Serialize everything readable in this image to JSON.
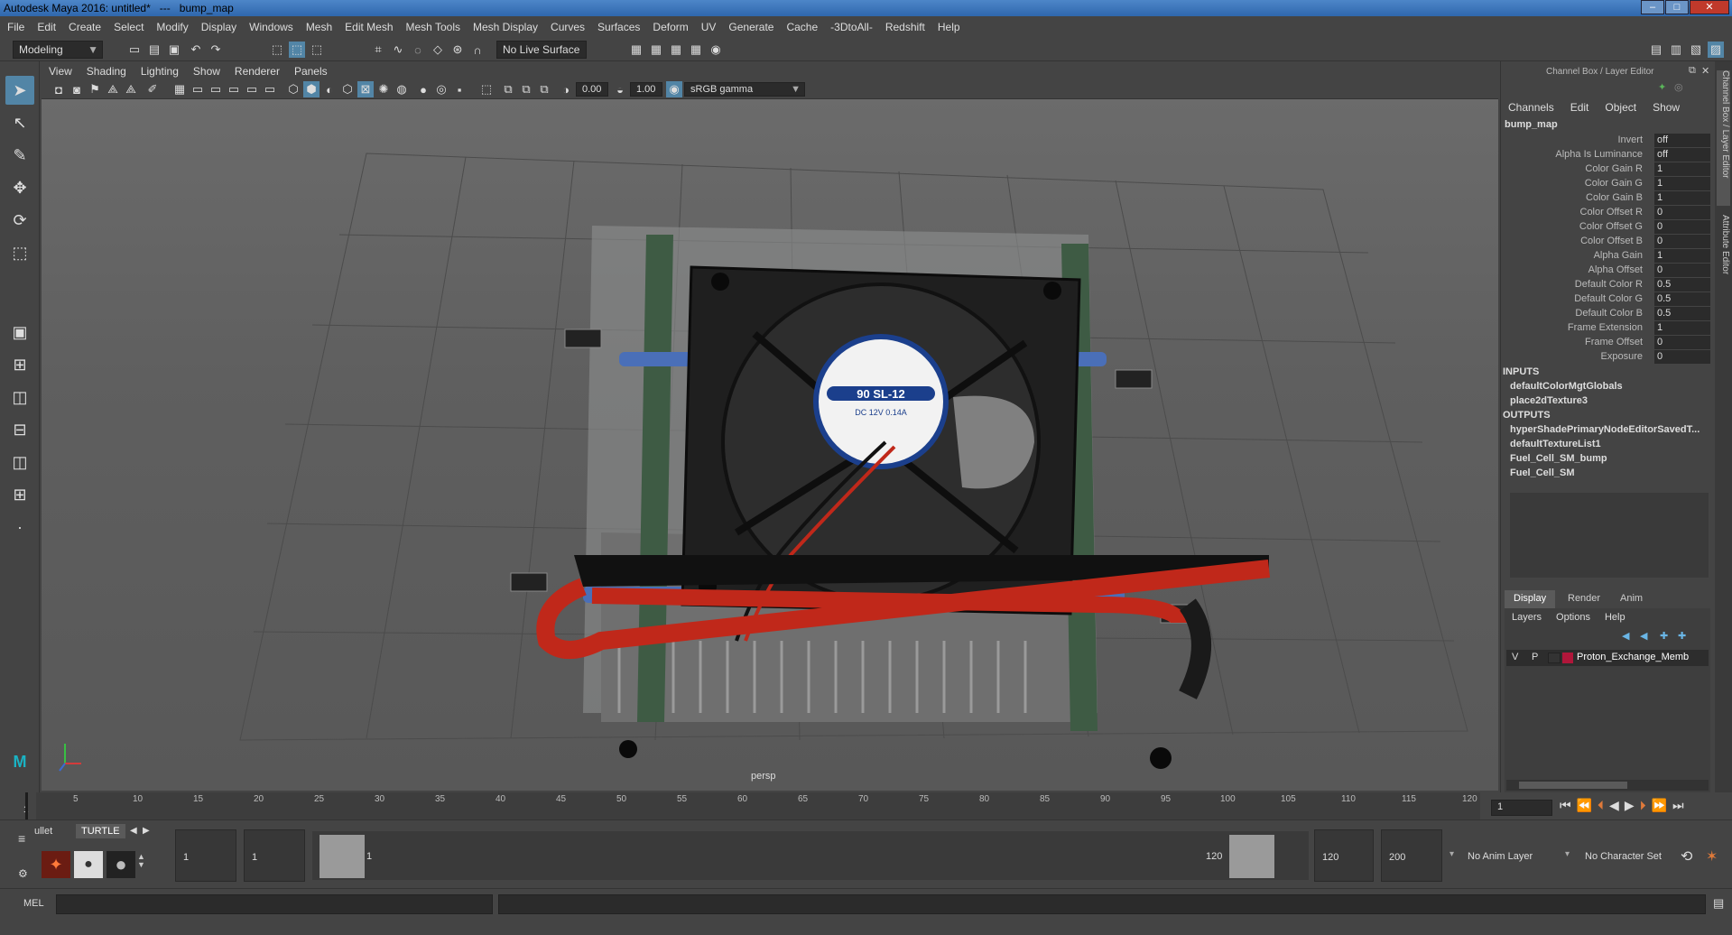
{
  "titlebar": {
    "app_title": "Autodesk Maya 2016: untitled*   ---   bump_map",
    "min": "–",
    "max": "□",
    "close": "✕"
  },
  "menus": [
    "File",
    "Edit",
    "Create",
    "Select",
    "Modify",
    "Display",
    "Windows",
    "Mesh",
    "Edit Mesh",
    "Mesh Tools",
    "Mesh Display",
    "Curves",
    "Surfaces",
    "Deform",
    "UV",
    "Generate",
    "Cache",
    "-3DtoAll-",
    "Redshift",
    "Help"
  ],
  "statusline": {
    "mode": "Modeling",
    "live_surface": "No Live Surface"
  },
  "panel_menu": [
    "View",
    "Shading",
    "Lighting",
    "Show",
    "Renderer",
    "Panels"
  ],
  "panel_toolbar": {
    "field1": "0.00",
    "field2": "1.00",
    "color_space": "sRGB gamma"
  },
  "viewport": {
    "camera_label": "persp",
    "fan_label_main": "90 SL-12",
    "fan_label_sub": "DC 12V 0.14A"
  },
  "channel_box": {
    "panel_title": "Channel Box / Layer Editor",
    "menus": [
      "Channels",
      "Edit",
      "Object",
      "Show"
    ],
    "node_name": "bump_map",
    "attributes": [
      {
        "name": "Invert",
        "value": "off"
      },
      {
        "name": "Alpha Is Luminance",
        "value": "off"
      },
      {
        "name": "Color Gain R",
        "value": "1"
      },
      {
        "name": "Color Gain G",
        "value": "1"
      },
      {
        "name": "Color Gain B",
        "value": "1"
      },
      {
        "name": "Color Offset R",
        "value": "0"
      },
      {
        "name": "Color Offset G",
        "value": "0"
      },
      {
        "name": "Color Offset B",
        "value": "0"
      },
      {
        "name": "Alpha Gain",
        "value": "1"
      },
      {
        "name": "Alpha Offset",
        "value": "0"
      },
      {
        "name": "Default Color R",
        "value": "0.5"
      },
      {
        "name": "Default Color G",
        "value": "0.5"
      },
      {
        "name": "Default Color B",
        "value": "0.5"
      },
      {
        "name": "Frame Extension",
        "value": "1"
      },
      {
        "name": "Frame Offset",
        "value": "0"
      },
      {
        "name": "Exposure",
        "value": "0"
      }
    ],
    "inputs_label": "INPUTS",
    "inputs": [
      "defaultColorMgtGlobals",
      "place2dTexture3"
    ],
    "outputs_label": "OUTPUTS",
    "outputs": [
      "hyperShadePrimaryNodeEditorSavedT...",
      "defaultTextureList1",
      "Fuel_Cell_SM_bump",
      "Fuel_Cell_SM"
    ]
  },
  "layer_editor": {
    "tabs": [
      "Display",
      "Render",
      "Anim"
    ],
    "menus": [
      "Layers",
      "Options",
      "Help"
    ],
    "layer": {
      "v": "V",
      "p": "P",
      "name": "Proton_Exchange_Memb",
      "color": "#b0163a"
    }
  },
  "side_tabs": [
    "Channel Box / Layer Editor",
    "Attribute Editor"
  ],
  "time_slider": {
    "ticks": [
      "5",
      "10",
      "15",
      "20",
      "25",
      "30",
      "35",
      "40",
      "45",
      "50",
      "55",
      "60",
      "65",
      "70",
      "75",
      "80",
      "85",
      "90",
      "95",
      "100",
      "105",
      "110",
      "115",
      "120"
    ],
    "start_label": "1",
    "current_frame": "1"
  },
  "range_slider": {
    "shelf_tabs": [
      "ullet",
      "TURTLE"
    ],
    "start_time": "1",
    "playback_start": "1",
    "range_start_label": "1",
    "range_end_label": "120",
    "playback_end": "120",
    "end_time": "200",
    "anim_layer": "No Anim Layer",
    "character_set": "No Character Set"
  },
  "command_line": {
    "label": "MEL"
  }
}
